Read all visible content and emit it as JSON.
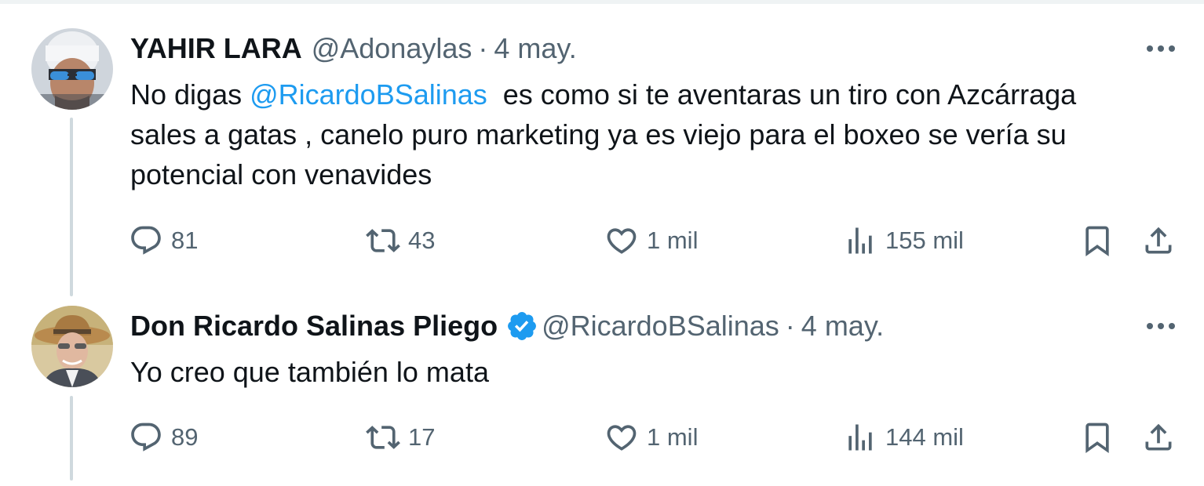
{
  "tweets": [
    {
      "name": "YAHIR LARA",
      "handle": "@Adonaylas",
      "separator": "·",
      "date": "4 may.",
      "text": {
        "line1_prefix": "No digas ",
        "line1_mention": "@RicardoBSalinas",
        "line1_suffix": "  es como si te aventaras un tiro con Azcárraga",
        "line2": "sales a gatas , canelo puro marketing ya es viejo para el boxeo se vería su",
        "line3": "potencial con venavides"
      },
      "replies": "81",
      "retweets": "43",
      "likes": "1 mil",
      "views": "155 mil"
    },
    {
      "name": "Don Ricardo Salinas Pliego",
      "handle": "@RicardoBSalinas",
      "separator": "·",
      "date": "4 may.",
      "verified": true,
      "text": {
        "line1": "Yo creo que también lo mata"
      },
      "replies": "89",
      "retweets": "17",
      "likes": "1 mil",
      "views": "144 mil"
    }
  ],
  "icons": {
    "reply": "reply-icon",
    "retweet": "retweet-icon",
    "like": "heart-icon",
    "views": "views-icon",
    "bookmark": "bookmark-icon",
    "share": "share-icon",
    "more": "more-icon",
    "verified": "verified-badge-icon"
  },
  "colors": {
    "text": "#0f1419",
    "secondary": "#536471",
    "mention": "#1d9bf0",
    "verified": "#1d9bf0",
    "thread_line": "#cfd9de"
  }
}
